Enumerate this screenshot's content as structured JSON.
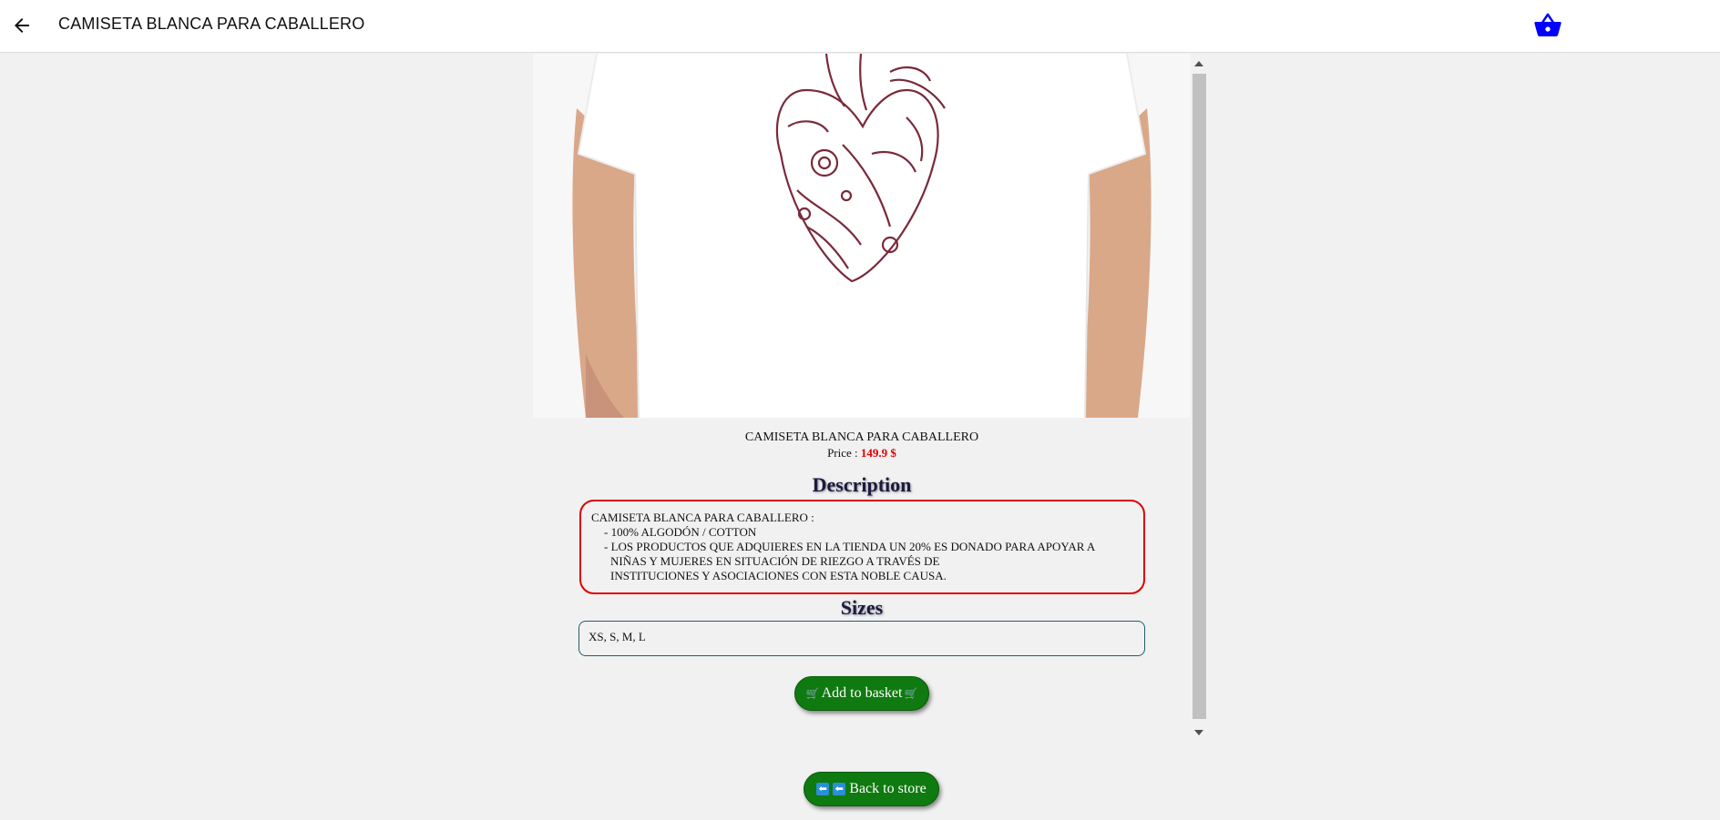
{
  "header": {
    "title": "CAMISETA BLANCA PARA CABALLERO"
  },
  "product": {
    "name": "CAMISETA BLANCA PARA CABALLERO",
    "price_label": "Price :",
    "price_value": "149.9 $",
    "description_heading": "Description",
    "description_lines": [
      "CAMISETA BLANCA PARA CABALLERO :",
      "- 100% ALGODÓN / COTTON",
      "- LOS PRODUCTOS QUE ADQUIERES EN LA TIENDA UN 20% ES DONADO PARA APOYAR A",
      "NIÑAS Y MUJERES EN SITUACIÓN DE RIEZGO A TRAVÉS DE",
      "INSTITUCIONES Y ASOCIACIONES CON ESTA NOBLE CAUSA."
    ],
    "sizes_heading": "Sizes",
    "sizes_value": "XS, S, M, L"
  },
  "actions": {
    "add_to_basket": "Add to basket",
    "back_to_store": "Back to store"
  },
  "colors": {
    "accent_blue": "#0000ff",
    "button_green": "#0f7a0f",
    "price_red": "#e00000",
    "description_border": "#e00000"
  },
  "icons": {
    "back": "arrow-left-icon",
    "basket": "shopping-basket-icon",
    "cart": "cart-icon",
    "back_emoji": "left-arrow-emoji-icon"
  }
}
